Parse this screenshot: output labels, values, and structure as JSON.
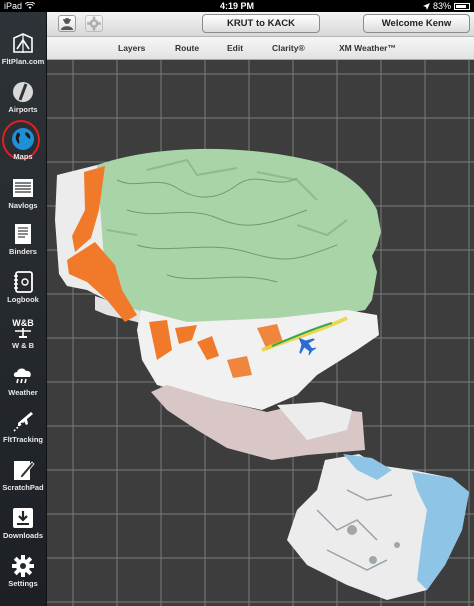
{
  "status_bar": {
    "device": "iPad",
    "time": "4:19 PM",
    "battery": "83%",
    "battery_level": 0.83
  },
  "sidebar": {
    "items": [
      {
        "label": "FltPlan.com",
        "icon": "fltplan-logo-icon"
      },
      {
        "label": "Airports",
        "icon": "airport-icon"
      },
      {
        "label": "Maps",
        "icon": "globe-icon",
        "active": true
      },
      {
        "label": "Navlogs",
        "icon": "navlog-icon"
      },
      {
        "label": "Binders",
        "icon": "binder-icon"
      },
      {
        "label": "Logbook",
        "icon": "logbook-icon"
      },
      {
        "label": "W & B",
        "icon": "weight-balance-icon",
        "icon_text": "W&B"
      },
      {
        "label": "Weather",
        "icon": "weather-icon"
      },
      {
        "label": "FltTracking",
        "icon": "flight-tracking-icon"
      },
      {
        "label": "ScratchPad",
        "icon": "scratchpad-icon"
      },
      {
        "label": "Downloads",
        "icon": "download-icon"
      },
      {
        "label": "Settings",
        "icon": "gear-icon"
      }
    ]
  },
  "toolbar": {
    "route_button": "KRUT to KACK",
    "welcome_button": "Welcome Kenw",
    "left_icons": [
      "pilot-icon",
      "gear-icon"
    ]
  },
  "menu": {
    "items": [
      "Layers",
      "Route",
      "Edit",
      "Clarity®",
      "XM Weather™"
    ]
  },
  "map": {
    "background_color": "#3d3d3d",
    "grid_color": "#7a7a7a",
    "aircraft_icon": "aircraft-icon",
    "chart_colors": {
      "canada_green": "#a9d4a8",
      "orange_areas": "#f07a2a",
      "water_blue": "#8ec5e6"
    }
  }
}
